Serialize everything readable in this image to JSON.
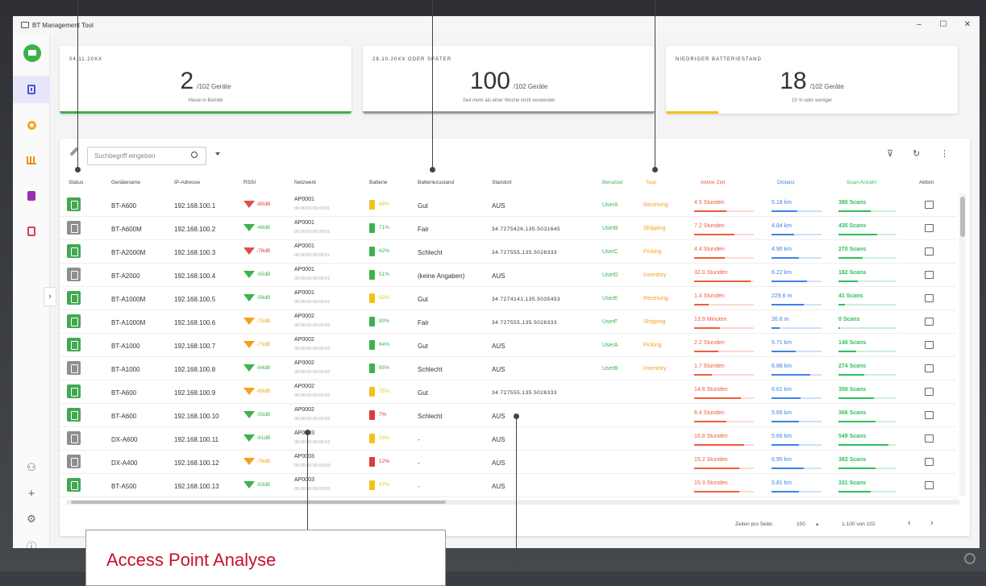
{
  "window": {
    "title": "BT Management Tool",
    "controls": [
      "–",
      "☐",
      "✕"
    ]
  },
  "cards": [
    {
      "title": "04.11.20XX",
      "value": "2",
      "total": "/102 Geräte",
      "subtitle": "Heute in Betrieb",
      "accent": "#3db24b",
      "fill": 1.0
    },
    {
      "title": "28.10.20XX ODER SPÄTER",
      "value": "100",
      "total": "/102 Geräte",
      "subtitle": "Seit mehr als einer Woche nicht verwendet",
      "accent": "#999999",
      "fill": 1.0
    },
    {
      "title": "NIEDRIGER BATTERIESTAND",
      "value": "18",
      "total": "/102 Geräte",
      "subtitle": "15 % oder weniger",
      "accent": "#f2c21c",
      "fill": 0.18
    }
  ],
  "search": {
    "placeholder": "Suchbegriff eingeben"
  },
  "columns": [
    "Status",
    "Gerätename",
    "IP-Adresse",
    "RSSI",
    "Netzwerk",
    "Batterie",
    "Batteriezustand",
    "Standort",
    "Benutzer",
    "Task",
    "Aktive Zeit",
    "Distanz",
    "Scan-Anzahl",
    "Aktion"
  ],
  "rows": [
    {
      "status": "on",
      "name": "BT-A600",
      "ip": "192.168.100.1",
      "rssi": "-80dB",
      "rssi_color": "#e03a3a",
      "rssi_shape": "outline",
      "ap": "AP0001",
      "mac": "00:00:00:00:00:01",
      "battery": "49%",
      "batt_color": "#f2c21c",
      "zustand": "Gut",
      "standort": "AUS",
      "user": "UserA",
      "task": "Receiving",
      "zeit": "4.5 Stunden",
      "dist": "5.18 km",
      "scans": "380 Scans"
    },
    {
      "status": "off",
      "name": "BT-A600M",
      "ip": "192.168.100.2",
      "rssi": "-48dB",
      "rssi_color": "#3db24b",
      "rssi_shape": "fill",
      "ap": "AP0001",
      "mac": "00:00:00:00:00:01",
      "battery": "71%",
      "batt_color": "#3db24b",
      "zustand": "Fair",
      "standort": "34.7275426,135.5031645",
      "user": "UserB",
      "task": "Shipping",
      "zeit": "7.2 Stunden",
      "dist": "4.84 km",
      "scans": "435 Scans"
    },
    {
      "status": "on",
      "name": "BT-A2000M",
      "ip": "192.168.100.3",
      "rssi": "-78dB",
      "rssi_color": "#e03a3a",
      "rssi_shape": "outline",
      "ap": "AP0001",
      "mac": "00:00:00:00:00:01",
      "battery": "62%",
      "batt_color": "#3db24b",
      "zustand": "Schlecht",
      "standort": "34.727555,135.5026333",
      "user": "UserC",
      "task": "Picking",
      "zeit": "4.4 Stunden",
      "dist": "4.90 km",
      "scans": "270 Scans"
    },
    {
      "status": "off",
      "name": "BT-A2000",
      "ip": "192.168.100.4",
      "rssi": "-55dB",
      "rssi_color": "#3db24b",
      "rssi_shape": "fill",
      "ap": "AP0001",
      "mac": "00:00:00:00:00:01",
      "battery": "51%",
      "batt_color": "#3db24b",
      "zustand": "(keine Angaben)",
      "standort": "AUS",
      "user": "UserD",
      "task": "Inventory",
      "zeit": "32.0 Stunden",
      "dist": "6.22 km",
      "scans": "182 Scans"
    },
    {
      "status": "on",
      "name": "BT-A1000M",
      "ip": "192.168.100.5",
      "rssi": "-58dB",
      "rssi_color": "#3db24b",
      "rssi_shape": "fill",
      "ap": "AP0001",
      "mac": "00:00:00:00:00:01",
      "battery": "50%",
      "batt_color": "#f2c21c",
      "zustand": "Gut",
      "standort": "34.7274141,135.5035453",
      "user": "UserE",
      "task": "Receiving",
      "zeit": "1.4 Stunden",
      "dist": "229.6 m",
      "scans": "41 Scans"
    },
    {
      "status": "on",
      "name": "BT-A1000M",
      "ip": "192.168.100.6",
      "rssi": "-75dB",
      "rssi_color": "#f2a21c",
      "rssi_shape": "fill",
      "ap": "AP0002",
      "mac": "00:00:00:00:00:02",
      "battery": "80%",
      "batt_color": "#3db24b",
      "zustand": "Fair",
      "standort": "34.727555,135.5026333",
      "user": "UserF",
      "task": "Shipping",
      "zeit": "13.9 Minuten",
      "dist": "26.6 m",
      "scans": "0 Scans"
    },
    {
      "status": "on",
      "name": "BT-A1000",
      "ip": "192.168.100.7",
      "rssi": "-73dB",
      "rssi_color": "#f2a21c",
      "rssi_shape": "fill",
      "ap": "AP0002",
      "mac": "00:00:00:00:00:02",
      "battery": "64%",
      "batt_color": "#3db24b",
      "zustand": "Gut",
      "standort": "AUS",
      "user": "UserA",
      "task": "Picking",
      "zeit": "2.2 Stunden",
      "dist": "5.71 km",
      "scans": "148 Scans"
    },
    {
      "status": "off",
      "name": "BT-A1000",
      "ip": "192.168.100.8",
      "rssi": "-64dB",
      "rssi_color": "#3db24b",
      "rssi_shape": "fill",
      "ap": "AP0002",
      "mac": "00:00:00:00:00:02",
      "battery": "85%",
      "batt_color": "#3db24b",
      "zustand": "Schlecht",
      "standort": "AUS",
      "user": "UserB",
      "task": "Inventory",
      "zeit": "1.7 Stunden",
      "dist": "6.88 km",
      "scans": "274 Scans"
    },
    {
      "status": "on",
      "name": "BT-A600",
      "ip": "192.168.100.9",
      "rssi": "-69dB",
      "rssi_color": "#f2a21c",
      "rssi_shape": "fill",
      "ap": "AP0002",
      "mac": "00:00:00:00:00:02",
      "battery": "25%",
      "batt_color": "#f2c21c",
      "zustand": "Gut",
      "standort": "34.727555,135.5026333",
      "user": "",
      "task": "",
      "zeit": "14.6 Stunden",
      "dist": "6.61 km",
      "scans": "359 Scans"
    },
    {
      "status": "on",
      "name": "BT-A600",
      "ip": "192.168.100.10",
      "rssi": "-55dB",
      "rssi_color": "#3db24b",
      "rssi_shape": "fill",
      "ap": "AP0002",
      "mac": "00:00:00:00:00:02",
      "battery": "7%",
      "batt_color": "#e03a3a",
      "zustand": "Schlecht",
      "standort": "AUS",
      "user": "",
      "task": "",
      "zeit": "6.4 Stunden",
      "dist": "5.65 km",
      "scans": "366 Scans"
    },
    {
      "status": "off",
      "name": "DX-A600",
      "ip": "192.168.100.11",
      "rssi": "-61dB",
      "rssi_color": "#3db24b",
      "rssi_shape": "fill",
      "ap": "AP0003",
      "mac": "00:00:00:00:00:03",
      "battery": "29%",
      "batt_color": "#f2c21c",
      "zustand": "-",
      "standort": "AUS",
      "user": "",
      "task": "",
      "zeit": "16.8 Stunden",
      "dist": "5.66 km",
      "scans": "549 Scans"
    },
    {
      "status": "off",
      "name": "DX-A400",
      "ip": "192.168.100.12",
      "rssi": "-76dB",
      "rssi_color": "#f2a21c",
      "rssi_shape": "fill",
      "ap": "AP0003",
      "mac": "00:00:00:00:00:03",
      "battery": "12%",
      "batt_color": "#e03a3a",
      "zustand": "-",
      "standort": "AUS",
      "user": "",
      "task": "",
      "zeit": "15.2 Stunden",
      "dist": "6.95 km",
      "scans": "382 Scans"
    },
    {
      "status": "on",
      "name": "BT-A500",
      "ip": "192.168.100.13",
      "rssi": "-63dB",
      "rssi_color": "#3db24b",
      "rssi_shape": "fill",
      "ap": "AP0003",
      "mac": "00:00:00:00:00:03",
      "battery": "47%",
      "batt_color": "#f2c21c",
      "zustand": "-",
      "standort": "AUS",
      "user": "",
      "task": "",
      "zeit": "15.3 Stunden",
      "dist": "5.81 km",
      "scans": "331 Scans"
    }
  ],
  "footer": {
    "rows_per_page_label": "Zeilen pro Seite:",
    "rows_per_page": "100",
    "range": "1-100 von 102",
    "prev": "‹",
    "next": "›"
  },
  "callout": {
    "label": "Access Point Analyse"
  },
  "sidebar_bottom": [
    "network-icon",
    "plus-icon",
    "settings-icon",
    "info-icon"
  ],
  "colors": {
    "green": "#3db24b",
    "orange": "#f2a21c",
    "red": "#e03a3a",
    "blue": "#3d82e6",
    "accent_purple": "#4b4fd6"
  }
}
